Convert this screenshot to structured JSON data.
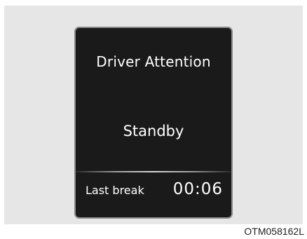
{
  "display": {
    "title": "Driver Attention",
    "status": "Standby",
    "last_break_label": "Last break",
    "last_break_value": "00:06"
  },
  "figure_code": "OTM058162L"
}
